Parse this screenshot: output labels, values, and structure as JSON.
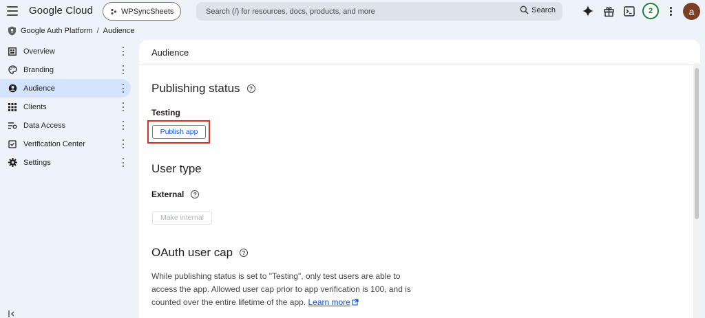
{
  "topbar": {
    "brand": "Google Cloud",
    "project": "WPSyncSheets",
    "search_placeholder": "Search (/) for resources, docs, products, and more",
    "search_button": "Search",
    "notification_count": "2",
    "avatar_letter": "a"
  },
  "breadcrumb": {
    "product": "Google Auth Platform",
    "separator": "/",
    "page": "Audience"
  },
  "sidebar": {
    "items": [
      {
        "label": "Overview",
        "icon": "dashboard-icon"
      },
      {
        "label": "Branding",
        "icon": "palette-icon"
      },
      {
        "label": "Audience",
        "icon": "person-icon",
        "active": true
      },
      {
        "label": "Clients",
        "icon": "grid-icon"
      },
      {
        "label": "Data Access",
        "icon": "data-access-icon"
      },
      {
        "label": "Verification Center",
        "icon": "verification-icon"
      },
      {
        "label": "Settings",
        "icon": "gear-icon"
      }
    ]
  },
  "main": {
    "header": "Audience",
    "publishing": {
      "title": "Publishing status",
      "status": "Testing",
      "button": "Publish app"
    },
    "user_type": {
      "title": "User type",
      "value": "External",
      "button": "Make internal"
    },
    "oauth": {
      "title": "OAuth user cap",
      "text": "While publishing status is set to \"Testing\", only test users are able to access the app. Allowed user cap prior to app verification is 100, and is counted over the entire lifetime of the app.",
      "link": "Learn more"
    }
  },
  "colors": {
    "accent": "#0b57d0",
    "active_nav": "#d3e3fd",
    "highlight": "#d93025",
    "badge": "#188038"
  }
}
